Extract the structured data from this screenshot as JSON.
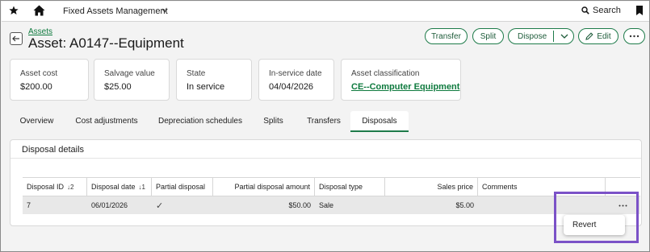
{
  "topbar": {
    "app_name": "Fixed Assets Management",
    "search_label": "Search"
  },
  "header": {
    "breadcrumb": "Assets",
    "title": "Asset: A0147--Equipment"
  },
  "actions": {
    "transfer": "Transfer",
    "split": "Split",
    "dispose": "Dispose",
    "edit": "Edit"
  },
  "cards": [
    {
      "label": "Asset cost",
      "value": "$200.00"
    },
    {
      "label": "Salvage value",
      "value": "$25.00"
    },
    {
      "label": "State",
      "value": "In service"
    },
    {
      "label": "In-service date",
      "value": "04/04/2026"
    },
    {
      "label": "Asset classification",
      "value": "CE--Computer Equipment"
    }
  ],
  "tabs": [
    "Overview",
    "Cost adjustments",
    "Depreciation schedules",
    "Splits",
    "Transfers",
    "Disposals"
  ],
  "active_tab": "Disposals",
  "section": {
    "title": "Disposal details"
  },
  "table": {
    "columns": [
      {
        "label": "Disposal ID",
        "sort": "↓2"
      },
      {
        "label": "Disposal date",
        "sort": "↓1"
      },
      {
        "label": "Partial disposal",
        "sort": ""
      },
      {
        "label": "Partial disposal amount",
        "sort": ""
      },
      {
        "label": "Disposal type",
        "sort": ""
      },
      {
        "label": "Sales price",
        "sort": ""
      },
      {
        "label": "Comments",
        "sort": ""
      }
    ],
    "rows": [
      {
        "disposal_id": "7",
        "disposal_date": "06/01/2026",
        "partial_disposal": "✓",
        "partial_disposal_amount": "$50.00",
        "disposal_type": "Sale",
        "sales_price": "$5.00",
        "comments": ""
      }
    ]
  },
  "row_menu": {
    "items": [
      "Revert"
    ]
  },
  "colors": {
    "accent": "#1e7b4a",
    "link": "#0e7a3e",
    "highlight": "#7b52c7"
  }
}
